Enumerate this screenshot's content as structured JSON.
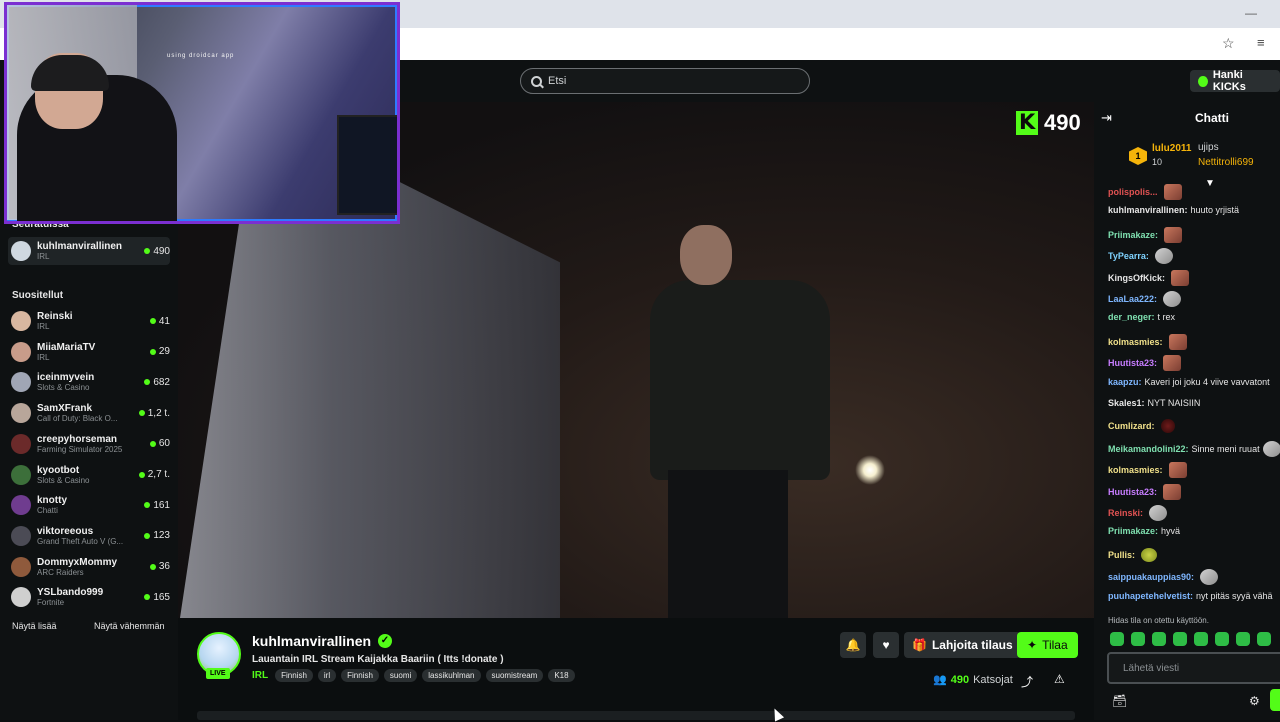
{
  "search": {
    "placeholder": "Etsi"
  },
  "nav": {
    "get_kicks_label": "Hanki KICKs"
  },
  "webcam": {
    "caption": "using droidcar app"
  },
  "sidebar": {
    "following_heading": "Seuratuissa",
    "following": [
      {
        "name": "kuhlmanvirallinen",
        "category": "IRL",
        "viewers": "490"
      }
    ],
    "recommended_heading": "Suositellut",
    "recommended": [
      {
        "name": "Reinski",
        "category": "IRL",
        "viewers": "41"
      },
      {
        "name": "MiiaMariaTV",
        "category": "IRL",
        "viewers": "29"
      },
      {
        "name": "iceinmyvein",
        "category": "Slots & Casino",
        "viewers": "682"
      },
      {
        "name": "SamXFrank",
        "category": "Call of Duty: Black O...",
        "viewers": "1,2 t."
      },
      {
        "name": "creepyhorseman",
        "category": "Farming Simulator 2025",
        "viewers": "60"
      },
      {
        "name": "kyootbot",
        "category": "Slots & Casino",
        "viewers": "2,7 t."
      },
      {
        "name": "knotty",
        "category": "Chatti",
        "viewers": "161"
      },
      {
        "name": "viktoreeous",
        "category": "Grand Theft Auto V (G...",
        "viewers": "123"
      },
      {
        "name": "DommyxMommy",
        "category": "ARC Raiders",
        "viewers": "36"
      },
      {
        "name": "YSLbando999",
        "category": "Fortnite",
        "viewers": "165"
      }
    ],
    "show_more": "Näytä lisää",
    "show_less": "Näytä vähemmän"
  },
  "video": {
    "overlay_viewers": "490"
  },
  "stream": {
    "streamer": "kuhlmanvirallinen",
    "live_label": "LIVE",
    "title": "Lauantain IRL Stream Kaijakka Baariin  ( Itts !donate )",
    "category": "IRL",
    "tags": [
      "Finnish",
      "irl",
      "Finnish",
      "suomi",
      "lassikuhlman",
      "suomistream",
      "K18"
    ],
    "gift_label": "Lahjoita tilaus",
    "subscribe_label": "Tilaa",
    "viewers": "490",
    "viewers_label": "Katsojat"
  },
  "chat": {
    "title": "Chatti",
    "top_supporter": {
      "rank": "1",
      "name": "lulu2011",
      "amount": "10"
    },
    "top_2": "ujips",
    "top_3": "Nettitrolli699",
    "messages": [
      {
        "user": "polispolis...",
        "text": "",
        "color": "#e05252"
      },
      {
        "user": "kuhlmanvirallinen:",
        "text": "huuto yrjistä",
        "color": "#e6e6e6"
      },
      {
        "user": "Priimakaze:",
        "text": "",
        "color": "#7fe0b0"
      },
      {
        "user": "TyPearra:",
        "text": "",
        "color": "#7fd3ff"
      },
      {
        "user": "KingsOfKick:",
        "text": "",
        "color": "#e6e6e6"
      },
      {
        "user": "LaaLaa222:",
        "text": "",
        "color": "#7fb7ff"
      },
      {
        "user": "der_neger:",
        "text": "t rex",
        "color": "#7fe0b0"
      },
      {
        "user": "kolmasmies:",
        "text": "",
        "color": "#f0e08a"
      },
      {
        "user": "Huutista23:",
        "text": "",
        "color": "#c77dff"
      },
      {
        "user": "kaapzu:",
        "text": "Kaveri joi joku 4 viive vavvatont",
        "color": "#7fb7ff"
      },
      {
        "user": "Skales1:",
        "text": "NYT NAISIIN",
        "color": "#e6e6e6"
      },
      {
        "user": "Cumlizard:",
        "text": "",
        "color": "#f0e08a"
      },
      {
        "user": "Meikamandolini22:",
        "text": "Sinne meni ruuat",
        "color": "#7fe0b0"
      },
      {
        "user": "kolmasmies:",
        "text": "",
        "color": "#f0e08a"
      },
      {
        "user": "Huutista23:",
        "text": "",
        "color": "#c77dff"
      },
      {
        "user": "Reinski:",
        "text": "",
        "color": "#e05252"
      },
      {
        "user": "Priimakaze:",
        "text": "hyvä",
        "color": "#7fe0b0"
      },
      {
        "user": "Pullis:",
        "text": "",
        "color": "#f0e08a"
      },
      {
        "user": "saippuakauppias90:",
        "text": "",
        "color": "#7fb7ff"
      },
      {
        "user": "puuhapetehelvetist:",
        "text": "nyt pitäs syyä vähä",
        "color": "#7fb7ff"
      }
    ],
    "slow_mode": "Hidas tila on otettu käyttöön.",
    "input_placeholder": "Lähetä viesti"
  },
  "colors": {
    "brand": "#53fc18",
    "background": "#0b0e0f",
    "panel": "#0e1112"
  }
}
